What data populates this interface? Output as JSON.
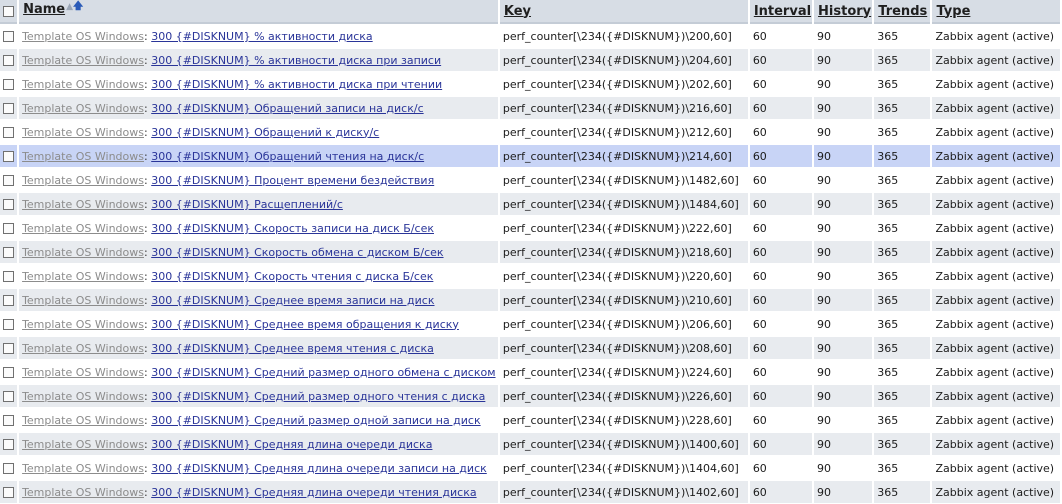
{
  "columns": {
    "name": "Name",
    "key": "Key",
    "interval": "Interval",
    "history": "History",
    "trends": "Trends",
    "type": "Type"
  },
  "sort": {
    "column": "Name",
    "direction": "ascending"
  },
  "highlighted_row_index": 5,
  "rows": [
    {
      "template": "Template OS Windows",
      "name": "300 {#DISKNUM} % активности диска",
      "key": "perf_counter[\\234({#DISKNUM})\\200,60]",
      "interval": "60",
      "history": "90",
      "trends": "365",
      "type": "Zabbix agent (active)"
    },
    {
      "template": "Template OS Windows",
      "name": "300 {#DISKNUM} % активности диска при записи",
      "key": "perf_counter[\\234({#DISKNUM})\\204,60]",
      "interval": "60",
      "history": "90",
      "trends": "365",
      "type": "Zabbix agent (active)"
    },
    {
      "template": "Template OS Windows",
      "name": "300 {#DISKNUM} % активности диска при чтении",
      "key": "perf_counter[\\234({#DISKNUM})\\202,60]",
      "interval": "60",
      "history": "90",
      "trends": "365",
      "type": "Zabbix agent (active)"
    },
    {
      "template": "Template OS Windows",
      "name": "300 {#DISKNUM} Обращений записи на диск/с",
      "key": "perf_counter[\\234({#DISKNUM})\\216,60]",
      "interval": "60",
      "history": "90",
      "trends": "365",
      "type": "Zabbix agent (active)"
    },
    {
      "template": "Template OS Windows",
      "name": "300 {#DISKNUM} Обращений к диску/с",
      "key": "perf_counter[\\234({#DISKNUM})\\212,60]",
      "interval": "60",
      "history": "90",
      "trends": "365",
      "type": "Zabbix agent (active)"
    },
    {
      "template": "Template OS Windows",
      "name": "300 {#DISKNUM} Обращений чтения на диск/с",
      "key": "perf_counter[\\234({#DISKNUM})\\214,60]",
      "interval": "60",
      "history": "90",
      "trends": "365",
      "type": "Zabbix agent (active)"
    },
    {
      "template": "Template OS Windows",
      "name": "300 {#DISKNUM} Процент времени бездействия",
      "key": "perf_counter[\\234({#DISKNUM})\\1482,60]",
      "interval": "60",
      "history": "90",
      "trends": "365",
      "type": "Zabbix agent (active)"
    },
    {
      "template": "Template OS Windows",
      "name": "300 {#DISKNUM} Расщеплений/с",
      "key": "perf_counter[\\234({#DISKNUM})\\1484,60]",
      "interval": "60",
      "history": "90",
      "trends": "365",
      "type": "Zabbix agent (active)"
    },
    {
      "template": "Template OS Windows",
      "name": "300 {#DISKNUM} Скорость записи на диск Б/сек",
      "key": "perf_counter[\\234({#DISKNUM})\\222,60]",
      "interval": "60",
      "history": "90",
      "trends": "365",
      "type": "Zabbix agent (active)"
    },
    {
      "template": "Template OS Windows",
      "name": "300 {#DISKNUM} Скорость обмена с диском Б/сек",
      "key": "perf_counter[\\234({#DISKNUM})\\218,60]",
      "interval": "60",
      "history": "90",
      "trends": "365",
      "type": "Zabbix agent (active)"
    },
    {
      "template": "Template OS Windows",
      "name": "300 {#DISKNUM} Скорость чтения с диска Б/сек",
      "key": "perf_counter[\\234({#DISKNUM})\\220,60]",
      "interval": "60",
      "history": "90",
      "trends": "365",
      "type": "Zabbix agent (active)"
    },
    {
      "template": "Template OS Windows",
      "name": "300 {#DISKNUM} Среднее время записи на диск",
      "key": "perf_counter[\\234({#DISKNUM})\\210,60]",
      "interval": "60",
      "history": "90",
      "trends": "365",
      "type": "Zabbix agent (active)"
    },
    {
      "template": "Template OS Windows",
      "name": "300 {#DISKNUM} Среднее время обращения к диску",
      "key": "perf_counter[\\234({#DISKNUM})\\206,60]",
      "interval": "60",
      "history": "90",
      "trends": "365",
      "type": "Zabbix agent (active)"
    },
    {
      "template": "Template OS Windows",
      "name": "300 {#DISKNUM} Среднее время чтения с диска",
      "key": "perf_counter[\\234({#DISKNUM})\\208,60]",
      "interval": "60",
      "history": "90",
      "trends": "365",
      "type": "Zabbix agent (active)"
    },
    {
      "template": "Template OS Windows",
      "name": "300 {#DISKNUM} Средний размер одного обмена с диском",
      "key": "perf_counter[\\234({#DISKNUM})\\224,60]",
      "interval": "60",
      "history": "90",
      "trends": "365",
      "type": "Zabbix agent (active)"
    },
    {
      "template": "Template OS Windows",
      "name": "300 {#DISKNUM} Средний размер одного чтения с диска",
      "key": "perf_counter[\\234({#DISKNUM})\\226,60]",
      "interval": "60",
      "history": "90",
      "trends": "365",
      "type": "Zabbix agent (active)"
    },
    {
      "template": "Template OS Windows",
      "name": "300 {#DISKNUM} Средний размер одной записи на диск",
      "key": "perf_counter[\\234({#DISKNUM})\\228,60]",
      "interval": "60",
      "history": "90",
      "trends": "365",
      "type": "Zabbix agent (active)"
    },
    {
      "template": "Template OS Windows",
      "name": "300 {#DISKNUM} Средняя длина очереди диска",
      "key": "perf_counter[\\234({#DISKNUM})\\1400,60]",
      "interval": "60",
      "history": "90",
      "trends": "365",
      "type": "Zabbix agent (active)"
    },
    {
      "template": "Template OS Windows",
      "name": "300 {#DISKNUM} Средняя длина очереди записи на диск",
      "key": "perf_counter[\\234({#DISKNUM})\\1404,60]",
      "interval": "60",
      "history": "90",
      "trends": "365",
      "type": "Zabbix agent (active)"
    },
    {
      "template": "Template OS Windows",
      "name": "300 {#DISKNUM} Средняя длина очереди чтения диска",
      "key": "perf_counter[\\234({#DISKNUM})\\1402,60]",
      "interval": "60",
      "history": "90",
      "trends": "365",
      "type": "Zabbix agent (active)"
    }
  ]
}
